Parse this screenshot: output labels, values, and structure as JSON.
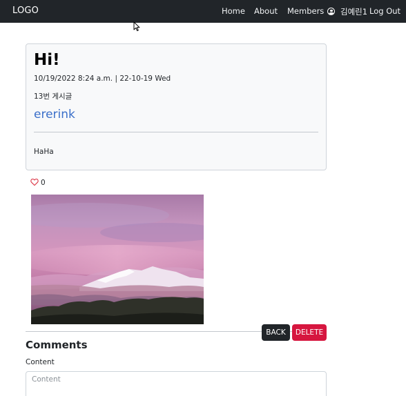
{
  "navbar": {
    "logo": "LOGO",
    "links": [
      "Home",
      "About",
      "Members"
    ],
    "user_icon": "user-circle-icon",
    "username": "김예린1",
    "logout": "Log Out"
  },
  "post": {
    "title": "Hi!",
    "meta": "10/19/2022 8:24 a.m. | 22-10-19 Wed",
    "board": "13번 게시글",
    "author": "ererink",
    "body": "HaHa"
  },
  "likes": {
    "icon": "heart-icon",
    "count": "0"
  },
  "actions": {
    "back_label": "BACK",
    "delete_label": "DELETE"
  },
  "comments": {
    "title": "Comments",
    "content_label": "Content",
    "content_placeholder": "Content"
  },
  "colors": {
    "navbar": "#212529",
    "link": "#3a6fc9",
    "delete": "#d6163f",
    "like": "#dc3545"
  }
}
